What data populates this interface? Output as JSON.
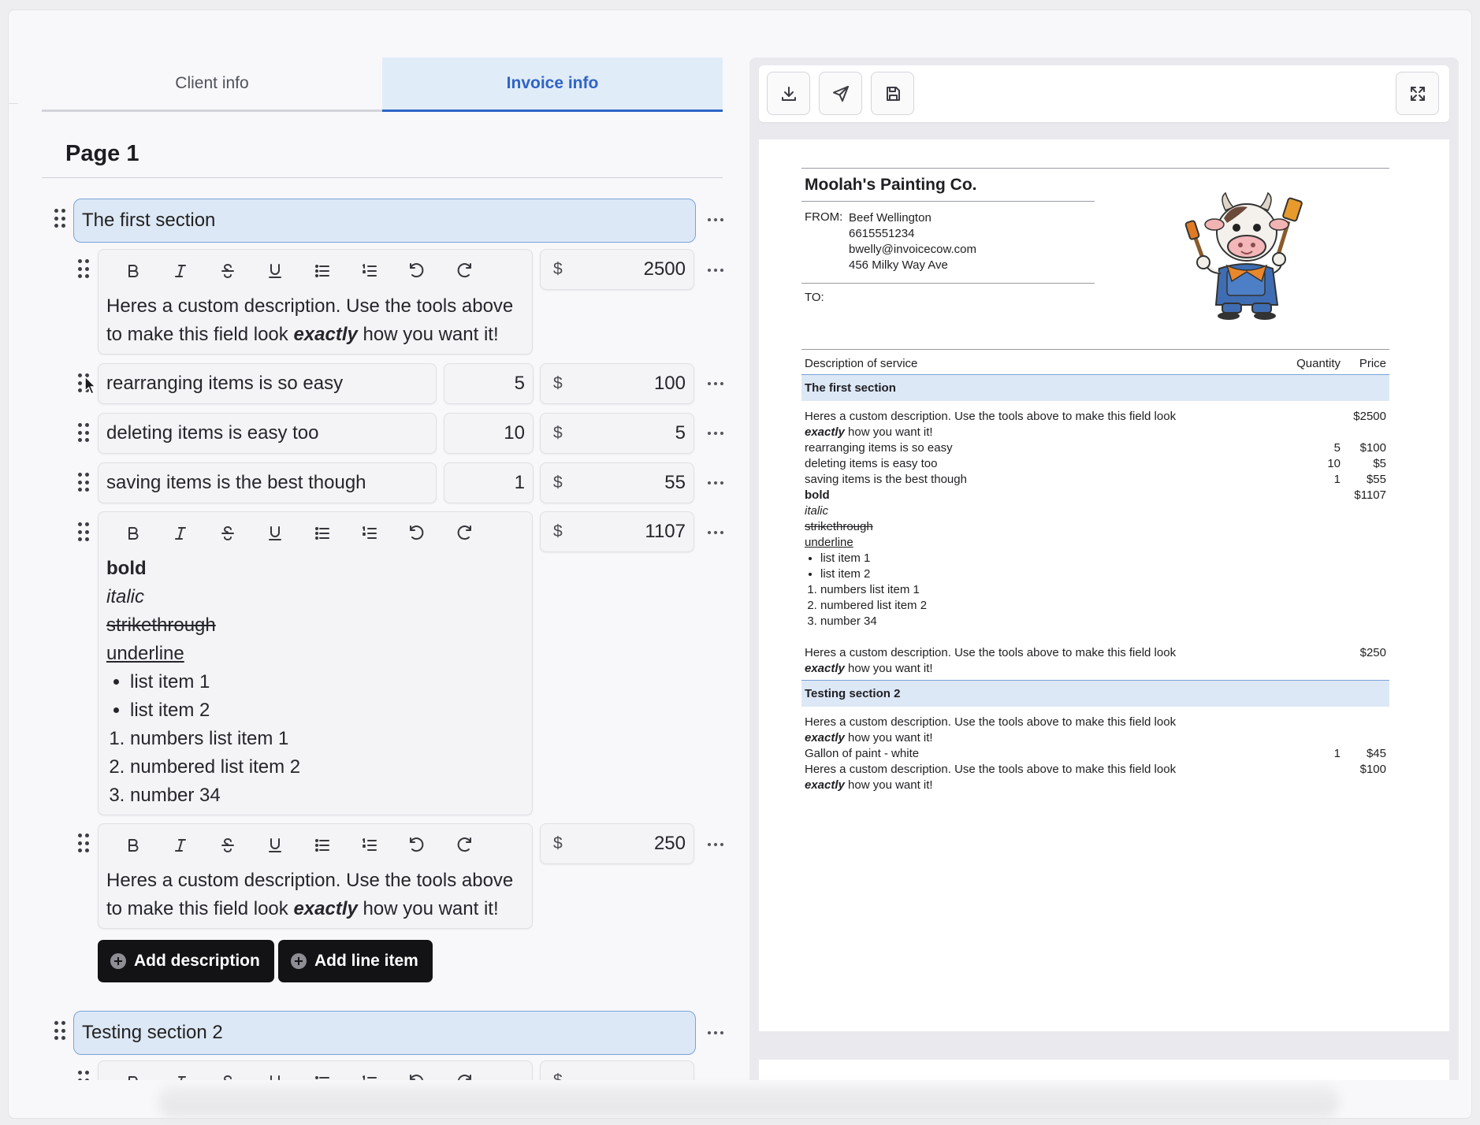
{
  "tabs": [
    {
      "label": "Client info",
      "active": false
    },
    {
      "label": "Invoice info",
      "active": true
    }
  ],
  "page": {
    "title": "Page 1"
  },
  "editor": {
    "section1": {
      "title": "The first section"
    },
    "desc1": {
      "text_a": "Heres a custom description. Use the tools above to make this field look ",
      "text_em": "exactly",
      "text_b": " how you want it!",
      "price_currency": "$",
      "price": "2500"
    },
    "items": [
      {
        "name": "rearranging items is so easy",
        "qty": "5",
        "currency": "$",
        "price": "100"
      },
      {
        "name": "deleting items is easy too",
        "qty": "10",
        "currency": "$",
        "price": "5"
      },
      {
        "name": "saving items is the best though",
        "qty": "1",
        "currency": "$",
        "price": "55"
      }
    ],
    "rich": {
      "bold": "bold",
      "italic": "italic",
      "strike": "strikethrough",
      "underline": "underline",
      "bullets": [
        "list item 1",
        "list item 2"
      ],
      "numbered": [
        "numbers list item 1",
        "numbered list item 2",
        "number 34"
      ],
      "currency": "$",
      "price": "1107"
    },
    "desc2": {
      "text_a": "Heres a custom description. Use the tools above to make this field look ",
      "text_em": "exactly",
      "text_b": " how you want it!",
      "currency": "$",
      "price": "250"
    },
    "add_description_label": "Add description",
    "add_line_item_label": "Add line item",
    "section2": {
      "title": "Testing section 2"
    }
  },
  "toolbar_icons": [
    "bold-icon",
    "italic-icon",
    "strikethrough-icon",
    "underline-icon",
    "bullet-list-icon",
    "numbered-list-icon",
    "undo-icon",
    "redo-icon"
  ],
  "preview_toolbar_icons": [
    "download-icon",
    "send-icon",
    "save-icon",
    "fullscreen-icon"
  ],
  "invoice": {
    "company": "Moolah's Painting Co.",
    "from_label": "FROM:",
    "from_lines": [
      "Beef Wellington",
      "6615551234",
      "bwelly@invoicecow.com",
      "456 Milky Way Ave"
    ],
    "to_label": "TO:",
    "columns": {
      "description": "Description of service",
      "quantity": "Quantity",
      "price": "Price"
    },
    "section1": "The first section",
    "section2": "Testing section 2",
    "desc_a": "Heres a custom description. Use the tools above to make this field look",
    "desc_em": "exactly",
    "desc_b": " how you want it!",
    "rows1": [
      {
        "desc": "rearranging items is so easy",
        "qty": "5",
        "price": "$100"
      },
      {
        "desc": "deleting items is easy too",
        "qty": "10",
        "price": "$5"
      },
      {
        "desc": "saving items is the best though",
        "qty": "1",
        "price": "$55"
      }
    ],
    "price_desc1": "$2500",
    "price_rich": "$1107",
    "price_desc2": "$250",
    "rich": {
      "bold": "bold",
      "italic": "italic",
      "strike": "strikethrough",
      "underline": "underline",
      "bullets": [
        "list item 1",
        "list item 2"
      ],
      "numbered": [
        "numbers list item 1",
        "numbered list item 2",
        "number 34"
      ]
    },
    "row_paint": {
      "desc": "Gallon of paint - white",
      "qty": "1",
      "price": "$45"
    },
    "price_s2_desc2": "$100"
  },
  "colors": {
    "accent": "#2e64c6",
    "section_fill": "#dde8f6",
    "dark_button": "#131316"
  }
}
